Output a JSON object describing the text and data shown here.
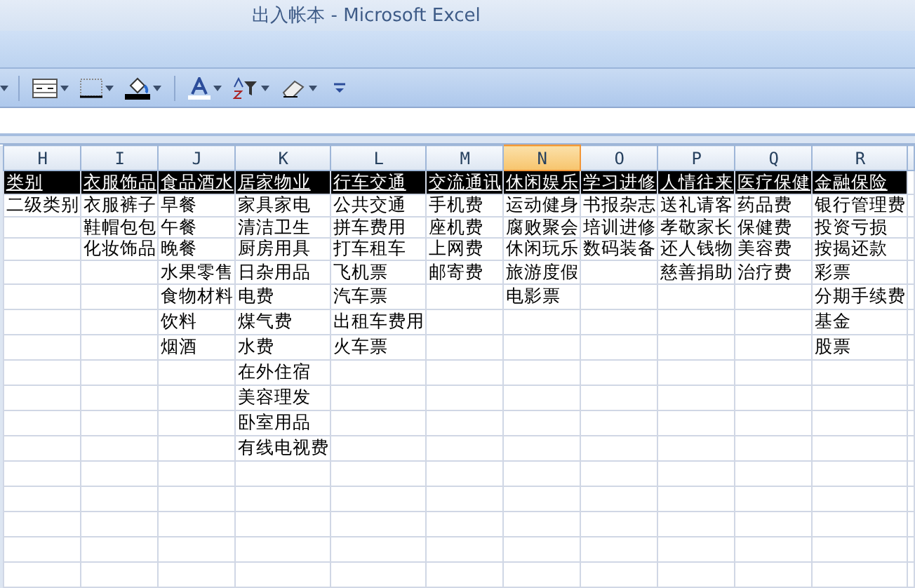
{
  "window": {
    "title": "出入帐本 - Microsoft Excel"
  },
  "sheet": {
    "columns": [
      {
        "letter": "H",
        "selected": false,
        "cells": [
          "类别",
          "二级类别"
        ]
      },
      {
        "letter": "I",
        "selected": false,
        "cells": [
          "衣服饰品",
          "衣服裤子",
          "鞋帽包包",
          "化妆饰品"
        ]
      },
      {
        "letter": "J",
        "selected": false,
        "cells": [
          "食品酒水",
          "早餐",
          "午餐",
          "晚餐",
          "水果零售",
          "食物材料",
          "饮料",
          "烟酒"
        ]
      },
      {
        "letter": "K",
        "selected": false,
        "cells": [
          "居家物业",
          "家具家电",
          "清洁卫生",
          "厨房用具",
          "日杂用品",
          "电费",
          "煤气费",
          "水费",
          "在外住宿",
          "美容理发",
          "卧室用品",
          "有线电视费"
        ]
      },
      {
        "letter": "L",
        "selected": false,
        "cells": [
          "行车交通",
          "公共交通",
          "拼车费用",
          "打车租车",
          "飞机票",
          "汽车票",
          "出租车费用",
          "火车票"
        ]
      },
      {
        "letter": "M",
        "selected": false,
        "cells": [
          "交流通讯",
          "手机费",
          "座机费",
          "上网费",
          "邮寄费"
        ]
      },
      {
        "letter": "N",
        "selected": true,
        "cells": [
          "休闲娱乐",
          "运动健身",
          "腐败聚会",
          "休闲玩乐",
          "旅游度假",
          "电影票"
        ]
      },
      {
        "letter": "O",
        "selected": false,
        "cells": [
          "学习进修",
          "书报杂志",
          "培训进修",
          "数码装备"
        ]
      },
      {
        "letter": "P",
        "selected": false,
        "cells": [
          "人情往来",
          "送礼请客",
          "孝敬家长",
          "还人钱物",
          "慈善捐助"
        ]
      },
      {
        "letter": "Q",
        "selected": false,
        "cells": [
          "医疗保健",
          "药品费",
          "保健费",
          "美容费",
          "治疗费"
        ]
      },
      {
        "letter": "R",
        "selected": false,
        "cells": [
          "金融保险",
          "银行管理费",
          "投资亏损",
          "按揭还款",
          "彩票",
          "分期手续费",
          "基金",
          "股票"
        ]
      }
    ]
  }
}
